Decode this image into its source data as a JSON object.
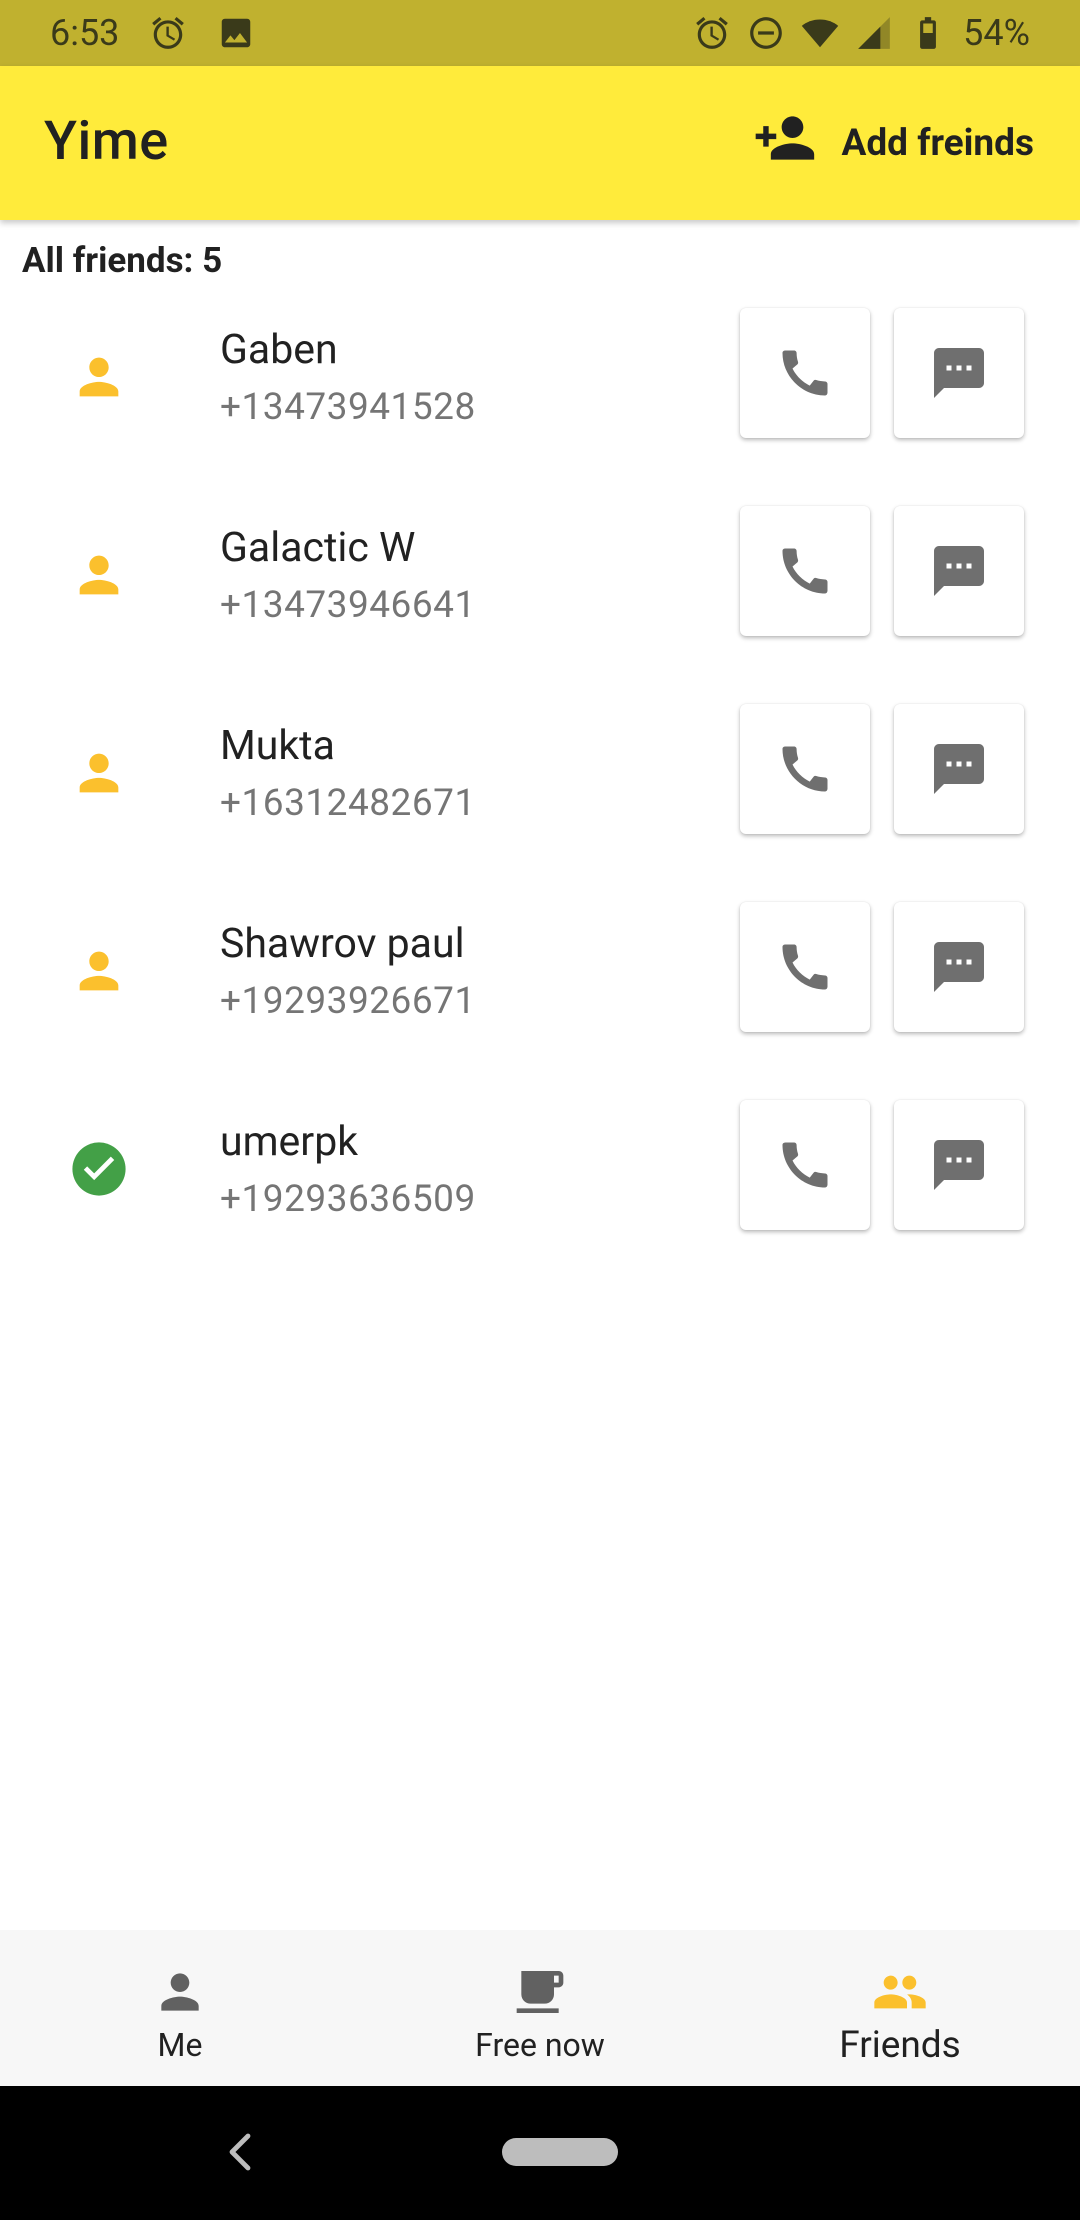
{
  "status_bar": {
    "time": "6:53",
    "battery": "54%",
    "icons_left": [
      "alarm-icon",
      "image-icon"
    ],
    "icons_right": [
      "alarm-icon",
      "do-not-disturb-icon",
      "wifi-icon",
      "signal-icon",
      "battery-icon"
    ]
  },
  "app_bar": {
    "title": "Yime",
    "add_friends_label": "Add freinds",
    "background": "#ffeb3b"
  },
  "friends": {
    "count_label": "All friends: 5",
    "items": [
      {
        "name": "Gaben",
        "phone": "+13473941528",
        "status": "person-icon"
      },
      {
        "name": "Galactic W",
        "phone": "+13473946641",
        "status": "person-icon"
      },
      {
        "name": "Mukta",
        "phone": "+16312482671",
        "status": "person-icon"
      },
      {
        "name": "Shawrov paul",
        "phone": "+19293926671",
        "status": "person-icon"
      },
      {
        "name": "umerpk",
        "phone": "+19293636509",
        "status": "check-circle-icon"
      }
    ]
  },
  "bottom_nav": {
    "items": [
      {
        "label": "Me",
        "icon": "person-icon",
        "active": false
      },
      {
        "label": "Free now",
        "icon": "coffee-icon",
        "active": false
      },
      {
        "label": "Friends",
        "icon": "people-icon",
        "active": true
      }
    ]
  },
  "colors": {
    "accent": "#fbc02d",
    "online": "#43a047",
    "status_bar": "#c0b12f"
  }
}
